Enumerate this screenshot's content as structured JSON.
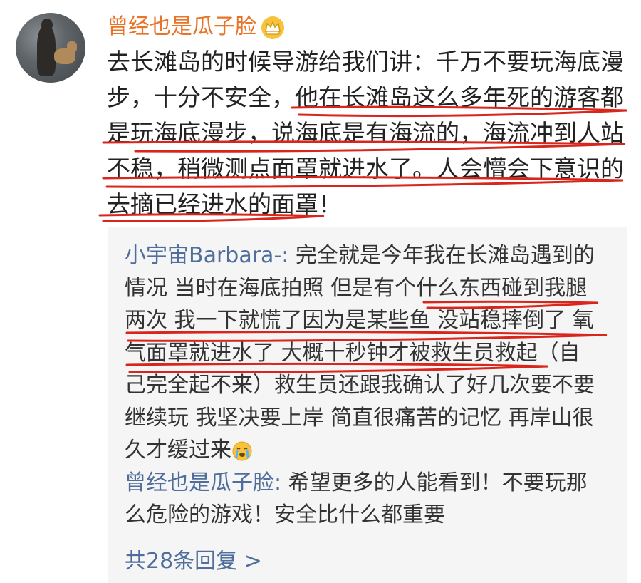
{
  "post": {
    "username": "曾经也是瓜子脸",
    "badge_icon": "crown-icon",
    "lines": [
      "去长滩岛的时候导游给我们讲：千万不要玩海底漫",
      "步，十分不安全，他在长滩岛这么多年死的游客都",
      "是玩海底漫步，说海底是有海流的，海流冲到人站",
      "不稳，稍微测点面罩就进水了。人会懵会下意识的",
      "去摘已经进水的面罩！"
    ]
  },
  "replies": [
    {
      "author": "小宇宙Barbara-",
      "separator": ":",
      "lines": [
        " 完全就是今年我在长滩岛遇到的",
        "情况 当时在海底拍照 但是有个什么东西碰到我腿",
        "两次 我一下就慌了因为是某些鱼 没站稳摔倒了 氧",
        "气面罩就进水了 大概十秒钟才被救生员救起（自",
        "己完全起不来）救生员还跟我确认了好几次要不要",
        "继续玩 我坚决要上岸 简直很痛苦的记忆 再岸山很",
        "久才缓过来"
      ],
      "trailing_icon": "crying-face-icon"
    },
    {
      "author": "曾经也是瓜子脸",
      "separator": ":",
      "lines": [
        " 希望更多的人能看到！不要玩那",
        "么危险的游戏！安全比什么都重要"
      ]
    }
  ],
  "more_replies": "共28条回复 >",
  "colors": {
    "username": "#e8742a",
    "link": "#4f6e9c",
    "annotation": "#d9261c",
    "reply_bg": "#f5f5f5"
  }
}
